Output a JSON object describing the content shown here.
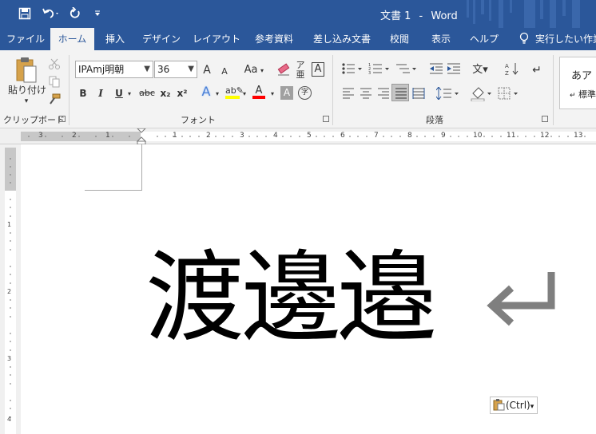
{
  "app": {
    "title": "文書 1",
    "separator": "-",
    "app_name": "Word"
  },
  "qat": {
    "save_icon": "save-icon",
    "undo_icon": "undo-icon",
    "redo_icon": "redo-icon",
    "customize_icon": "customize-qat-icon"
  },
  "tabs": [
    {
      "label": "ファイル"
    },
    {
      "label": "ホーム",
      "active": true
    },
    {
      "label": "挿入"
    },
    {
      "label": "デザイン"
    },
    {
      "label": "レイアウト"
    },
    {
      "label": "参考資料"
    },
    {
      "label": "差し込み文書"
    },
    {
      "label": "校閲"
    },
    {
      "label": "表示"
    },
    {
      "label": "ヘルプ"
    }
  ],
  "tell_me": "実行したい作業",
  "ribbon": {
    "clipboard": {
      "paste_label": "貼り付け",
      "paste_arrow": "▾",
      "group_label": "クリップボード"
    },
    "font": {
      "font_name": "IPAmj明朝",
      "font_size": "36",
      "group_label": "フォント",
      "bold": "B",
      "italic": "I",
      "underline": "U",
      "strike": "abc",
      "subscript": "x₂",
      "superscript": "x²",
      "grow": "A",
      "shrink": "A",
      "change_case": "Aa",
      "char_border": "A",
      "char_shading": "A",
      "enclosed": "字"
    },
    "paragraph": {
      "group_label": "段落"
    },
    "styles": {
      "sample": "あア",
      "name": "標準"
    }
  },
  "ruler": {
    "h_left": [
      "3",
      "2",
      "1"
    ],
    "h_right": [
      "1",
      "2",
      "3",
      "4",
      "5",
      "6",
      "7",
      "8",
      "9",
      "10",
      "11",
      "12",
      "13"
    ],
    "v": [
      "1",
      "2",
      "3",
      "4"
    ]
  },
  "document": {
    "text": "渡邊邉",
    "paragraph_mark": "↵"
  },
  "paste_options": {
    "label": "(Ctrl)",
    "arrow": "▾"
  },
  "colors": {
    "brand": "#2b579a",
    "ribbon_bg": "#f3f3f3",
    "highlight_yellow": "#ffff00",
    "font_red": "#ff0000"
  }
}
